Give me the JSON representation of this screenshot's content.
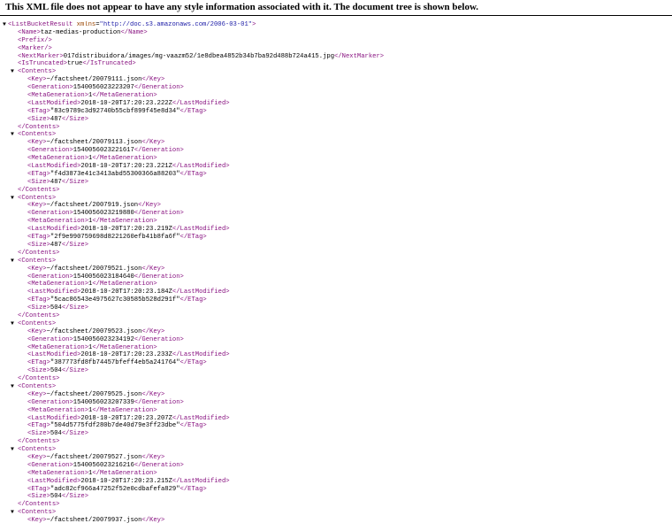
{
  "header": {
    "message": "This XML file does not appear to have any style information associated with it. The document tree is shown below."
  },
  "toggle_glyph": "▼",
  "root": {
    "open": "<ListBucketResult",
    "attr_name": " xmlns",
    "attr_eq": "=",
    "attr_value": "\"http://doc.s3.amazonaws.com/2006-03-01\"",
    "open_end": ">",
    "fields": [
      {
        "tag": "Name",
        "text": "taz-medias-production"
      },
      {
        "tag": "Prefix",
        "empty": true
      },
      {
        "tag": "Marker",
        "empty": true
      },
      {
        "tag": "NextMarker",
        "text": "017distribuidora/images/mg-vaazm52/1e8dbea4852b34b7ba92d488b724a415.jpg"
      },
      {
        "tag": "IsTruncated",
        "text": "true"
      }
    ],
    "contents": [
      {
        "Key": "~/factsheet/20079111.json",
        "Generation": "1540056023223207",
        "MetaGeneration": "1",
        "LastModified": "2018-10-20T17:20:23.222Z",
        "ETag": "\"83c9789c3d92740b55cbf899f45e8d34\"",
        "Size": "487"
      },
      {
        "Key": "~/factsheet/20079113.json",
        "Generation": "1540056023221617",
        "MetaGeneration": "1",
        "LastModified": "2018-10-20T17:20:23.221Z",
        "ETag": "\"f4d3873e41c3413abd55300366a88203\"",
        "Size": "487"
      },
      {
        "Key": "~/factsheet/2007919.json",
        "Generation": "1540056023219880",
        "MetaGeneration": "1",
        "LastModified": "2018-10-20T17:20:23.219Z",
        "ETag": "\"2f9e990759698d8221260efb41b8fa6f\"",
        "Size": "487"
      },
      {
        "Key": "~/factsheet/20079521.json",
        "Generation": "1540056023184640",
        "MetaGeneration": "1",
        "LastModified": "2018-10-20T17:20:23.184Z",
        "ETag": "\"5cac86543e4975627c30585b528d291f\"",
        "Size": "504"
      },
      {
        "Key": "~/factsheet/20079523.json",
        "Generation": "1540056023234192",
        "MetaGeneration": "1",
        "LastModified": "2018-10-20T17:20:23.233Z",
        "ETag": "\"387773fd8fb74457bfeff4eb5a241764\"",
        "Size": "504"
      },
      {
        "Key": "~/factsheet/20079525.json",
        "Generation": "1540056023207339",
        "MetaGeneration": "1",
        "LastModified": "2018-10-20T17:20:23.207Z",
        "ETag": "\"504d5775fdf280b7de40d79e3ff23dbe\"",
        "Size": "504"
      },
      {
        "Key": "~/factsheet/20079527.json",
        "Generation": "1540056023216216",
        "MetaGeneration": "1",
        "LastModified": "2018-10-20T17:20:23.215Z",
        "ETag": "\"adc82cf966a47252f52e0cdbafefa829\"",
        "Size": "504"
      },
      {
        "Key": "~/factsheet/20079937.json"
      }
    ]
  }
}
